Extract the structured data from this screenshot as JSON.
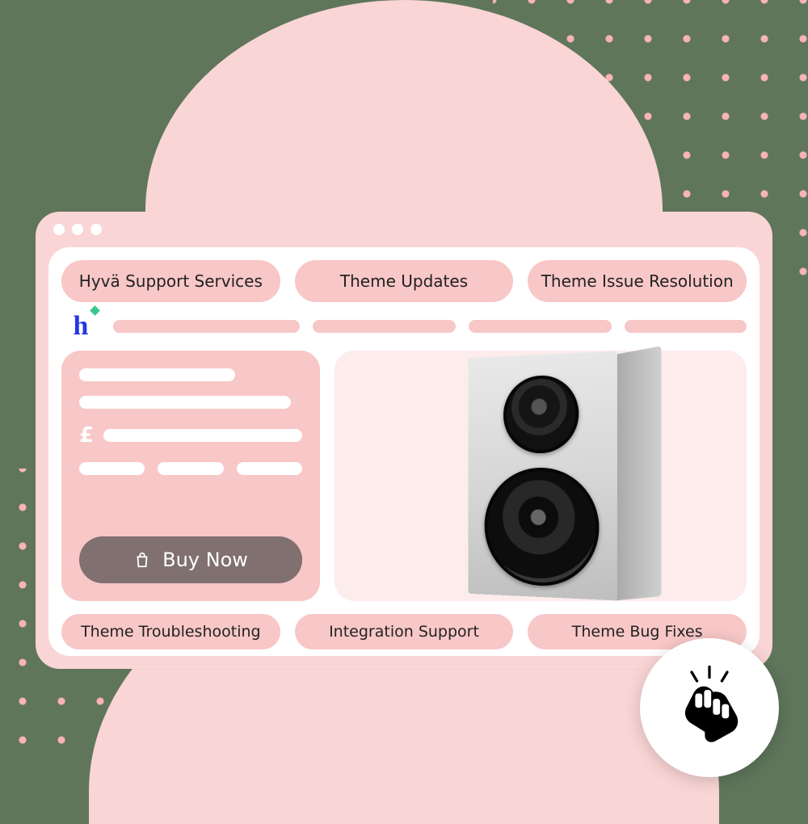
{
  "tabs_top": [
    {
      "label": "Hyvä Support Services"
    },
    {
      "label": "Theme Updates"
    },
    {
      "label": "Theme Issue Resolution"
    }
  ],
  "tabs_bottom": [
    {
      "label": "Theme Troubleshooting"
    },
    {
      "label": "Integration Support"
    },
    {
      "label": "Theme Bug Fixes"
    }
  ],
  "panel": {
    "currency": "£",
    "buy_label": "Buy Now"
  },
  "logo": {
    "letter": "h"
  }
}
